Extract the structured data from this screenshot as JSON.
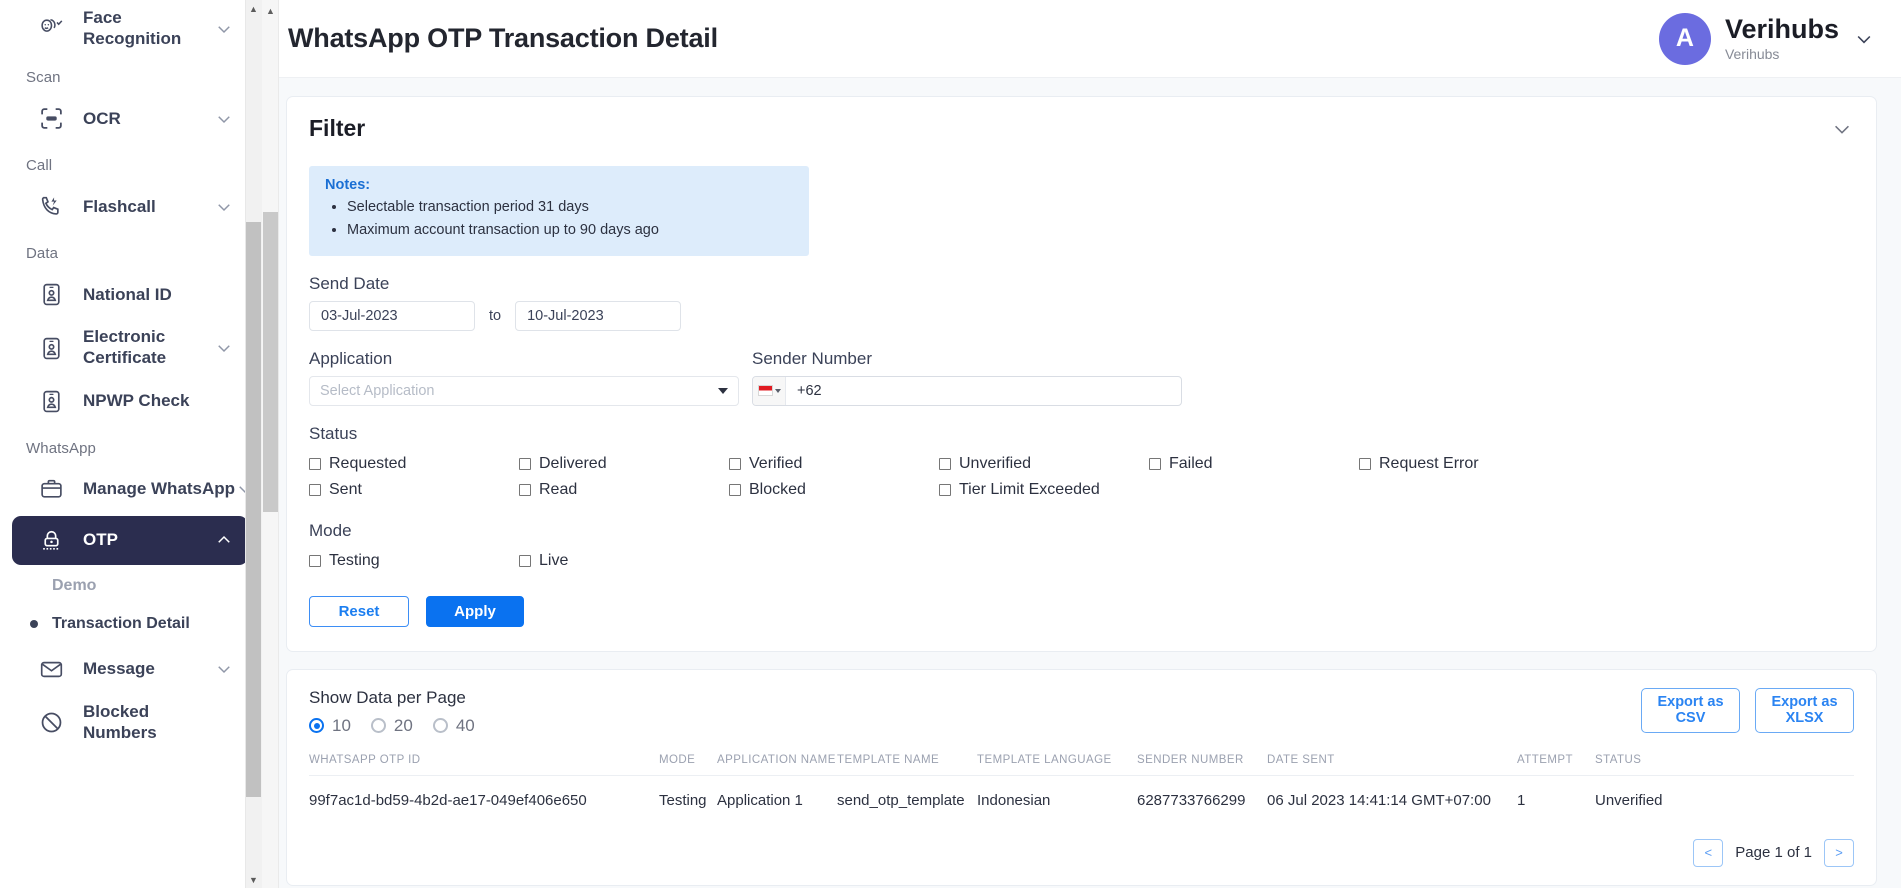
{
  "header": {
    "title": "WhatsApp OTP Transaction Detail",
    "account_initial": "A",
    "account_name": "Verihubs",
    "account_sub": "Verihubs",
    "chevron_icon": "chevron-down-icon",
    "accent_color": "#6b6ce0"
  },
  "sidebar": {
    "items": [
      {
        "type": "item",
        "label": "Face Recognition",
        "icon": "face-recognition-icon",
        "chevron": "chevron-down-icon",
        "active": false
      },
      {
        "type": "group",
        "label": "Scan"
      },
      {
        "type": "item",
        "label": "OCR",
        "icon": "ocr-scan-icon",
        "chevron": "chevron-down-icon",
        "active": false
      },
      {
        "type": "group",
        "label": "Call"
      },
      {
        "type": "item",
        "label": "Flashcall",
        "icon": "flashcall-icon",
        "chevron": "chevron-down-icon",
        "active": false
      },
      {
        "type": "group",
        "label": "Data"
      },
      {
        "type": "item",
        "label": "National ID",
        "icon": "id-card-icon",
        "chevron": "",
        "active": false
      },
      {
        "type": "item",
        "label": "Electronic Certificate",
        "icon": "id-card-icon",
        "chevron": "chevron-down-icon",
        "active": false
      },
      {
        "type": "item",
        "label": "NPWP Check",
        "icon": "id-card-icon",
        "chevron": "",
        "active": false
      },
      {
        "type": "group",
        "label": "WhatsApp"
      },
      {
        "type": "item",
        "label": "Manage WhatsApp",
        "icon": "briefcase-icon",
        "chevron": "chevron-down-icon",
        "active": false
      },
      {
        "type": "item",
        "label": "OTP",
        "icon": "otp-lock-icon",
        "chevron": "chevron-up-icon",
        "active": true
      },
      {
        "type": "sub",
        "label": "Demo",
        "selected": false
      },
      {
        "type": "sub",
        "label": "Transaction Detail",
        "selected": true
      },
      {
        "type": "item",
        "label": "Message",
        "icon": "envelope-icon",
        "chevron": "chevron-down-icon",
        "active": false
      },
      {
        "type": "item",
        "label": "Blocked Numbers",
        "icon": "blocked-icon",
        "chevron": "",
        "active": false
      }
    ]
  },
  "filter": {
    "title": "Filter",
    "collapse_icon": "chevron-down-icon",
    "notes_title": "Notes:",
    "notes": [
      "Selectable transaction period 31 days",
      "Maximum account transaction up to 90 days ago"
    ],
    "send_date_label": "Send Date",
    "date_from": "03-Jul-2023",
    "date_to_word": "to",
    "date_to": "10-Jul-2023",
    "application_label": "Application",
    "application_placeholder": "Select Application",
    "application_value": "",
    "sender_number_label": "Sender Number",
    "sender_number_value": "+62",
    "country_flag_icon": "indonesia-flag-icon",
    "status_label": "Status",
    "status_options": [
      "Requested",
      "Delivered",
      "Verified",
      "Unverified",
      "Failed",
      "Request Error",
      "Sent",
      "Read",
      "Blocked",
      "Tier Limit Exceeded"
    ],
    "mode_label": "Mode",
    "mode_options": [
      "Testing",
      "Live"
    ],
    "reset_label": "Reset",
    "apply_label": "Apply",
    "apply_color": "#0a72f0"
  },
  "table_panel": {
    "per_page_label": "Show Data per Page",
    "per_page_options": [
      "10",
      "20",
      "40"
    ],
    "per_page_selected": "10",
    "export_csv_label": "Export as CSV",
    "export_xlsx_label": "Export as XLSX",
    "columns": [
      "WHATSAPP OTP ID",
      "MODE",
      "APPLICATION NAME",
      "TEMPLATE NAME",
      "TEMPLATE LANGUAGE",
      "SENDER NUMBER",
      "DATE SENT",
      "ATTEMPT",
      "STATUS"
    ],
    "rows": [
      {
        "otp_id": "99f7ac1d-bd59-4b2d-ae17-049ef406e650",
        "mode": "Testing",
        "application_name": "Application 1",
        "template_name": "send_otp_template",
        "template_language": "Indonesian",
        "sender_number": "6287733766299",
        "date_sent": "06 Jul 2023 14:41:14 GMT+07:00",
        "attempt": "1",
        "status": "Unverified"
      }
    ],
    "pager": {
      "prev_label": "<",
      "next_label": ">",
      "page_text": "Page 1 of 1"
    }
  }
}
